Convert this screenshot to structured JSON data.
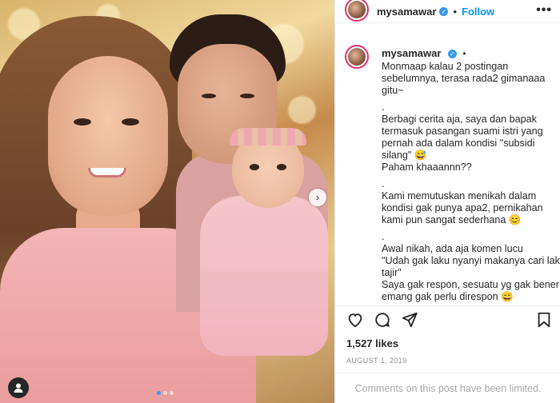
{
  "post": {
    "username": "mysamawar",
    "follow_label": "Follow",
    "more_label": "•••",
    "likes_label": "1,527 likes",
    "date_label": "AUGUST 1, 2019",
    "comments_limited_text": "Comments on this post have been limited.",
    "caption_lines": [
      "Monmaap kalau 2 postingan",
      "sebelumnya, terasa rada2 gimanaaa",
      "gitu~",
      ".",
      "Berbagi cerita aja, saya dan bapak",
      "termasuk pasangan suami istri yang",
      "pernah ada dalam kondisi \"subsidi",
      "silang\" 😅",
      "Paham khaaannn??",
      ".",
      "Kami memutuskan menikah dalam",
      "kondisi gak punya apa2, pernikahan",
      "kami pun sangat sederhana 😊",
      ".",
      "Awal nikah, ada aja komen lucu",
      "\"Udah gak laku nyanyi makanya cari laki",
      "tajir\"",
      "Saya gak respon, sesuatu yg gak bener",
      "emang gak perlu direspon 😄"
    ]
  },
  "icons": {
    "verified": "verified-check-icon",
    "like": "heart-icon",
    "comment": "comment-icon",
    "share": "send-icon",
    "save": "bookmark-icon",
    "tag": "user-tag-icon",
    "next": "chevron-right-icon"
  },
  "colors": {
    "accent": "#0095f6",
    "verified": "#3897f0",
    "text": "#262626",
    "muted": "#8e8e8e"
  },
  "carousel": {
    "total_slides": 3,
    "active_slide": 1
  }
}
